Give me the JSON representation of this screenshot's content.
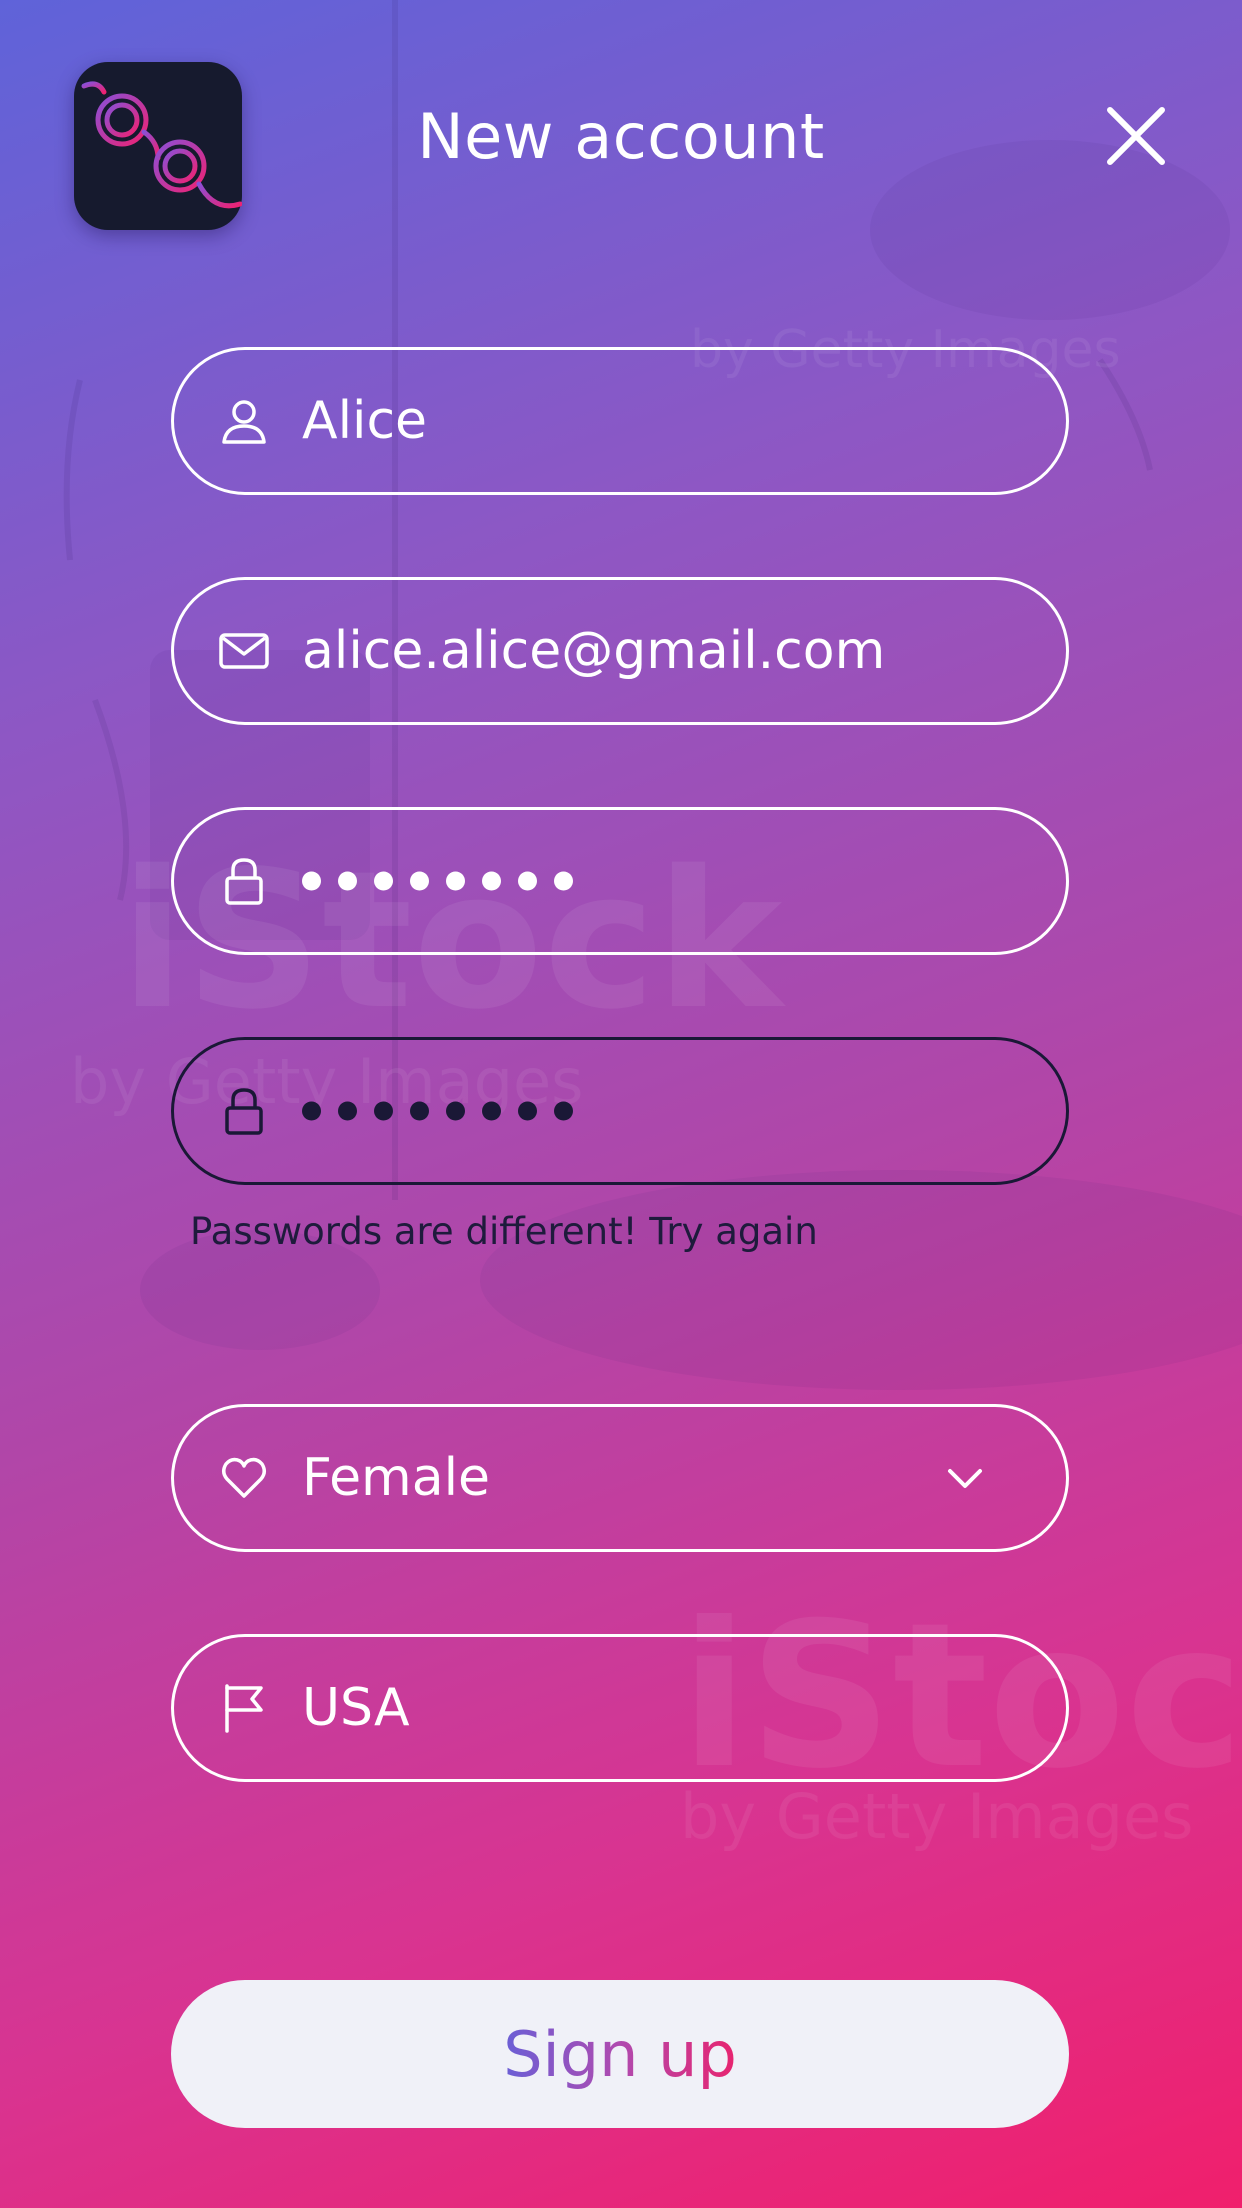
{
  "header": {
    "title": "New account",
    "close_icon": "close-icon",
    "logo_icon": "handcuffs-icon"
  },
  "watermark": {
    "text": "iStock",
    "sub": "by Getty Images"
  },
  "form": {
    "name": {
      "icon": "user-icon",
      "value": "Alice"
    },
    "email": {
      "icon": "mail-icon",
      "value": "alice.alice@gmail.com"
    },
    "password": {
      "icon": "lock-icon",
      "masked_length": 8
    },
    "confirm_password": {
      "icon": "lock-icon",
      "masked_length": 8,
      "state": "error"
    },
    "error_message": "Passwords are different! Try again",
    "gender": {
      "icon": "heart-icon",
      "value": "Female",
      "dropdown_icon": "chevron-down-icon"
    },
    "country": {
      "icon": "flag-icon",
      "value": "USA"
    }
  },
  "actions": {
    "signup_label": "Sign up"
  },
  "colors": {
    "gradient_top": "#5f63d9",
    "gradient_bottom": "#f01f6c",
    "error_border": "#1a1836",
    "logo_bg": "#161a2e",
    "button_bg": "#f0f1f8"
  }
}
